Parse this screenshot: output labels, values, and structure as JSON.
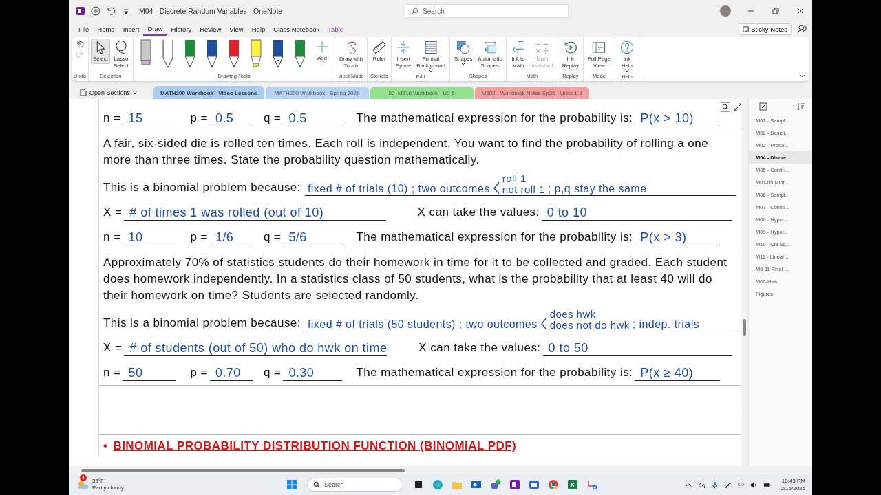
{
  "window": {
    "title": "M04 - Discrete Random Variables  -  OneNote",
    "search_placeholder": "Search"
  },
  "menu": [
    {
      "label": "File",
      "kind": "normal",
      "selected": false
    },
    {
      "label": "Home",
      "kind": "normal",
      "selected": false
    },
    {
      "label": "Insert",
      "kind": "normal",
      "selected": false
    },
    {
      "label": "Draw",
      "kind": "normal",
      "selected": true
    },
    {
      "label": "History",
      "kind": "normal",
      "selected": false
    },
    {
      "label": "Review",
      "kind": "normal",
      "selected": false
    },
    {
      "label": "View",
      "kind": "normal",
      "selected": false
    },
    {
      "label": "Help",
      "kind": "normal",
      "selected": false
    },
    {
      "label": "Class Notebook",
      "kind": "normal",
      "selected": false
    },
    {
      "label": "Table",
      "kind": "contextual",
      "selected": false
    }
  ],
  "sticky_notes": "Sticky Notes",
  "ribbon": [
    {
      "kind": "undo",
      "label": "Undo"
    },
    {
      "kind": "buttons",
      "label": "Selection",
      "buttons": [
        {
          "label": "Select",
          "selected": true
        },
        {
          "label": "Lasso\nSelect",
          "selected": false
        }
      ]
    },
    {
      "kind": "pens",
      "label": "Drawing Tools",
      "add": "Add",
      "pens": [
        {
          "kind": "eraser",
          "color": "#c8c8c8"
        },
        {
          "kind": "pencil",
          "color": "#ffffff"
        },
        {
          "kind": "pen",
          "color": "#1e8a3a"
        },
        {
          "kind": "pen",
          "color": "#1f4e9c"
        },
        {
          "kind": "pen",
          "color": "#e0202a"
        },
        {
          "kind": "highlighter",
          "color": "#fff23a"
        },
        {
          "kind": "fountain",
          "color": "#1f4e9c"
        },
        {
          "kind": "pen",
          "color": "#1e8a3a"
        }
      ]
    },
    {
      "kind": "buttons",
      "label": "Input Mode",
      "buttons": [
        {
          "label": "Draw with\nTouch"
        }
      ]
    },
    {
      "kind": "buttons",
      "label": "Stencils",
      "buttons": [
        {
          "label": "Ruler"
        }
      ]
    },
    {
      "kind": "buttons",
      "label": "Edit",
      "buttons": [
        {
          "label": "Insert\nSpace"
        },
        {
          "label": "Format\nBackground",
          "dropdown": true
        }
      ]
    },
    {
      "kind": "buttons",
      "label": "Shapes",
      "buttons": [
        {
          "label": "Shapes",
          "dropdown": true
        },
        {
          "label": "Automatic\nShapes"
        }
      ]
    },
    {
      "kind": "buttons",
      "label": "Math",
      "buttons": [
        {
          "label": "Ink to\nMath",
          "disabled": false
        },
        {
          "label": "Math\nAssistant",
          "disabled": true
        }
      ]
    },
    {
      "kind": "buttons",
      "label": "Replay",
      "buttons": [
        {
          "label": "Ink\nReplay"
        }
      ]
    },
    {
      "kind": "buttons",
      "label": "Mode",
      "buttons": [
        {
          "label": "Full Page\nView"
        }
      ]
    },
    {
      "kind": "buttons",
      "label": "Help",
      "buttons": [
        {
          "label": "Ink\nHelp",
          "dropdown": true
        }
      ]
    }
  ],
  "sections": {
    "open_label": "Open Sections",
    "tabs": [
      {
        "label": "MATH200 Workbook - Video Lessons",
        "color": "#a9cdf0",
        "selected": true
      },
      {
        "label": "MATH200 Workbook - Spring 2026",
        "color": "#b7d4f2",
        "selected": false
      },
      {
        "label": "00_M216 Workbook - U0-5",
        "color": "#93e08f",
        "selected": false
      },
      {
        "label": "M202 - Workbook Notes Sp26 - Units 1-2",
        "color": "#f5a0a0",
        "selected": false
      }
    ]
  },
  "problems": [
    {
      "n_label": "n =",
      "n": "15",
      "p_label": "p =",
      "p": "0.5",
      "q_label": "q =",
      "q": "0.5",
      "expr_label": "The mathematical expression for the probability is:",
      "expr": "P(x > 10)"
    },
    {
      "question": "A fair, six-sided die is rolled ten times. Each roll is independent. You want to find the probability of rolling a one more than three times. State the probability question mathematically.",
      "reason_label": "This is a binomial problem because:",
      "reason": {
        "before": "fixed # of trials (10) ; two outcomes",
        "options": [
          "roll 1",
          "not roll 1"
        ],
        "after": "; p,q stay the same"
      },
      "x_label": "X =",
      "x_value": "# of times 1 was rolled (out of 10)",
      "values_label": "X can take the values:",
      "values": "0 to 10",
      "n_label": "n =",
      "n": "10",
      "p_label": "p =",
      "p": "1/6",
      "q_label": "q =",
      "q": "5/6",
      "expr_label": "The mathematical expression for the probability is:",
      "expr": "P(x > 3)"
    },
    {
      "question": "Approximately 70% of statistics students do their homework in time for it to be collected and graded. Each student does homework independently. In a statistics class of 50 students, what is the probability that at least 40 will do their homework on time? Students are selected randomly.",
      "reason_label": "This is a binomial problem because:",
      "reason": {
        "before": "fixed # of trials (50 students) ; two outcomes",
        "options": [
          "does hwk",
          "does not do hwk"
        ],
        "after": "; indep. trials"
      },
      "x_label": "X =",
      "x_value": "# of students (out of 50) who do hwk on time",
      "values_label": "X can take the values:",
      "values": "0 to 50",
      "n_label": "n =",
      "n": "50",
      "p_label": "p =",
      "p": "0.70",
      "q_label": "q =",
      "q": "0.30",
      "expr_label": "The mathematical expression for the probability is:",
      "expr": "P(x ≥ 40)"
    }
  ],
  "heading": {
    "bullet": "•",
    "text": "BINOMIAL PROBABILITY DISTRIBUTION FUNCTION (BINOMIAL PDF)"
  },
  "pages": [
    {
      "label": "M01 - Sampl...",
      "selected": false
    },
    {
      "label": "M02 - Descri...",
      "selected": false
    },
    {
      "label": "M03 - Proba...",
      "selected": false
    },
    {
      "label": "M04 - Discre...",
      "selected": true
    },
    {
      "label": "M05 - Contin...",
      "selected": false
    },
    {
      "label": "M01-05 Midt...",
      "selected": false
    },
    {
      "label": "M06 - Sampl...",
      "selected": false
    },
    {
      "label": "M07 - Confid...",
      "selected": false
    },
    {
      "label": "M08 - Hypot...",
      "selected": false
    },
    {
      "label": "M09 - Hypot...",
      "selected": false
    },
    {
      "label": "M10 - Chi Sq...",
      "selected": false
    },
    {
      "label": "M11 - Linear...",
      "selected": false
    },
    {
      "label": "M6-11 Final ...",
      "selected": false
    },
    {
      "label": "M02-Hwk",
      "selected": false
    },
    {
      "label": "Figures",
      "selected": false
    }
  ],
  "taskbar": {
    "badge": "4",
    "temp": "35°F",
    "weather": "Partly cloudy",
    "search": "Search",
    "time": "10:43 PM",
    "date": "2/15/2026"
  }
}
